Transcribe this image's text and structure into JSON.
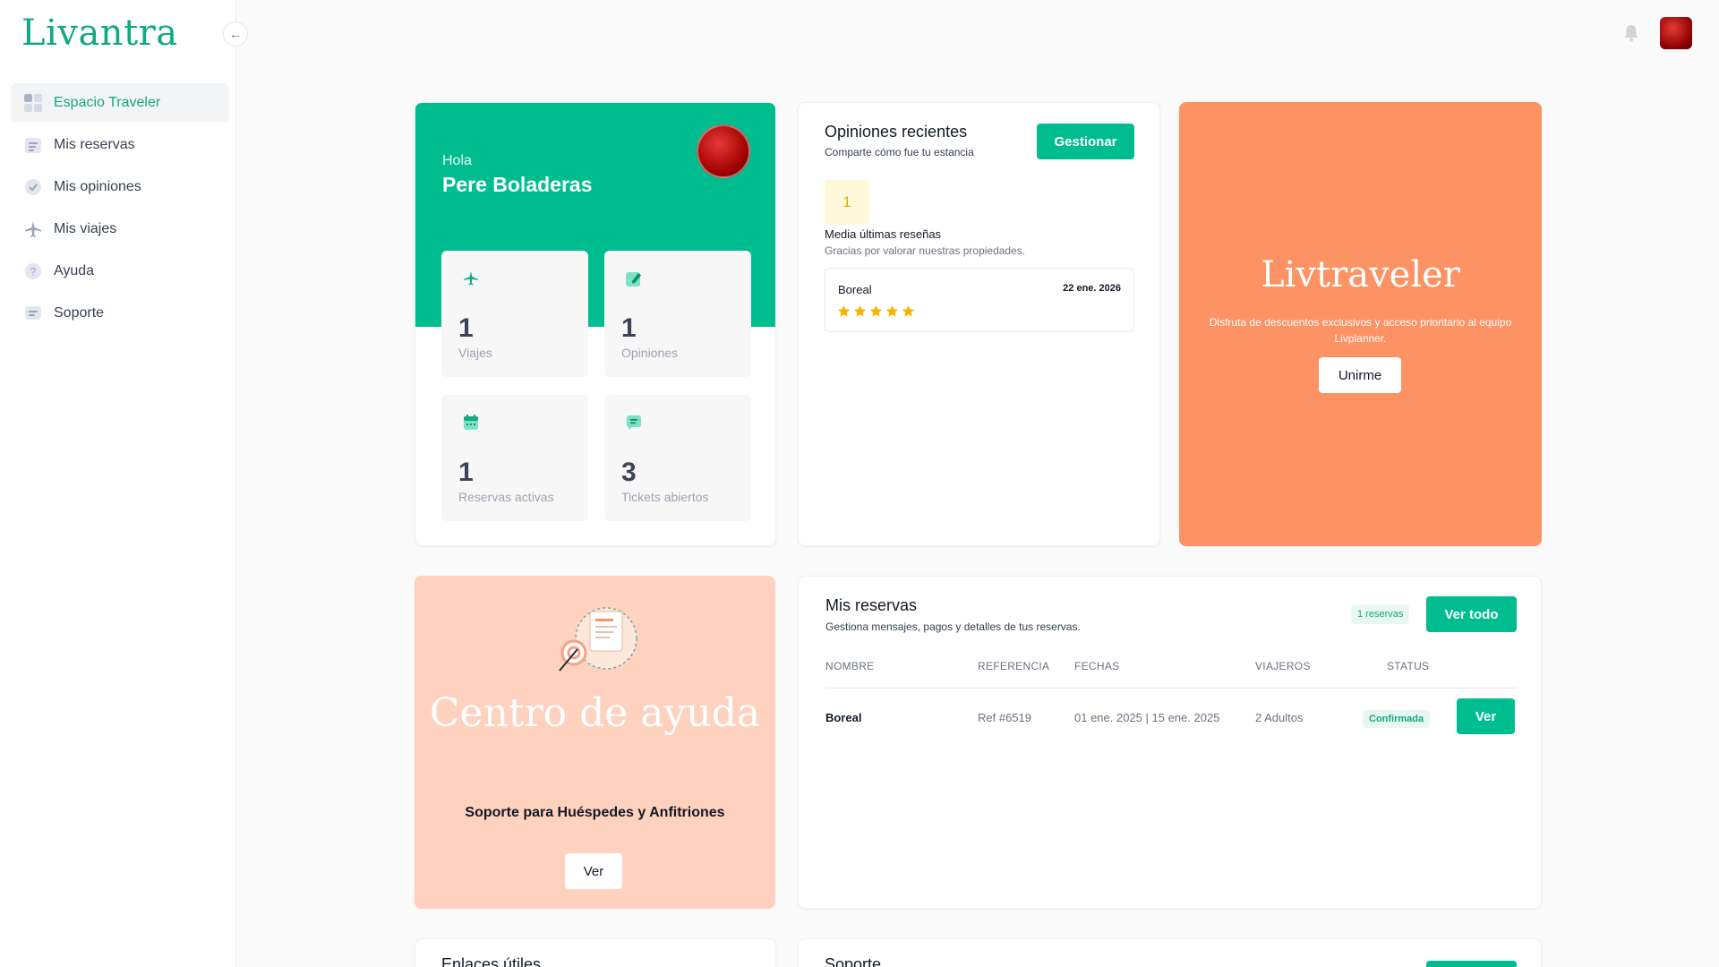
{
  "brand": {
    "logo": "Livantra",
    "accent": "#00bd8f"
  },
  "sidebar": {
    "items": [
      {
        "label": "Espacio Traveler",
        "icon": "grid-icon",
        "active": true
      },
      {
        "label": "Mis reservas",
        "icon": "calendar-list-icon"
      },
      {
        "label": "Mis opiniones",
        "icon": "check-badge-icon"
      },
      {
        "label": "Mis viajes",
        "icon": "plane-icon"
      },
      {
        "label": "Ayuda",
        "icon": "question-icon"
      },
      {
        "label": "Soporte",
        "icon": "chat-lines-icon"
      }
    ]
  },
  "welcome": {
    "greeting": "Hola",
    "name": "Pere Boladeras",
    "stats": [
      {
        "value": "1",
        "label": "Viajes",
        "icon": "plane-icon"
      },
      {
        "value": "1",
        "label": "Opiniones",
        "icon": "edit-note-icon"
      },
      {
        "value": "1",
        "label": "Reservas activas",
        "icon": "calendar-icon"
      },
      {
        "value": "3",
        "label": "Tickets abiertos",
        "icon": "chat-icon"
      }
    ]
  },
  "opiniones": {
    "title": "Opiniones recientes",
    "subtitle": "Comparte cómo fue tu estancia",
    "button": "Gestionar",
    "rating": "1",
    "media_label": "Media últimas reseñas",
    "thanks": "Gracias por valorar nuestras propiedades.",
    "review": {
      "name": "Boreal",
      "date": "22 ene. 2026",
      "stars": 5
    }
  },
  "livtraveler": {
    "title": "Livtraveler",
    "text": "Disfruta de descuentos exclusivos y acceso prioritario al equipo Livplanner.",
    "button": "Unirme"
  },
  "ayuda": {
    "title": "Centro de ayuda",
    "subtitle": "Soporte para Huéspedes y Anfitriones",
    "button": "Ver"
  },
  "reservas": {
    "title": "Mis reservas",
    "subtitle": "Gestiona mensajes, pagos y detalles de tus reservas.",
    "badge": "1 reservas",
    "button": "Ver todo",
    "columns": [
      "NOMBRE",
      "REFERENCIA",
      "FECHAS",
      "VIAJEROS",
      "STATUS"
    ],
    "rows": [
      {
        "name": "Boreal",
        "ref": "Ref #6519",
        "dates": "01 ene. 2025 | 15 ene. 2025",
        "travelers": "2 Adultos",
        "status": "Confirmada",
        "action": "Ver"
      }
    ]
  },
  "bottom": {
    "enlaces_title": "Enlaces útiles",
    "soporte_title": "Soporte"
  }
}
